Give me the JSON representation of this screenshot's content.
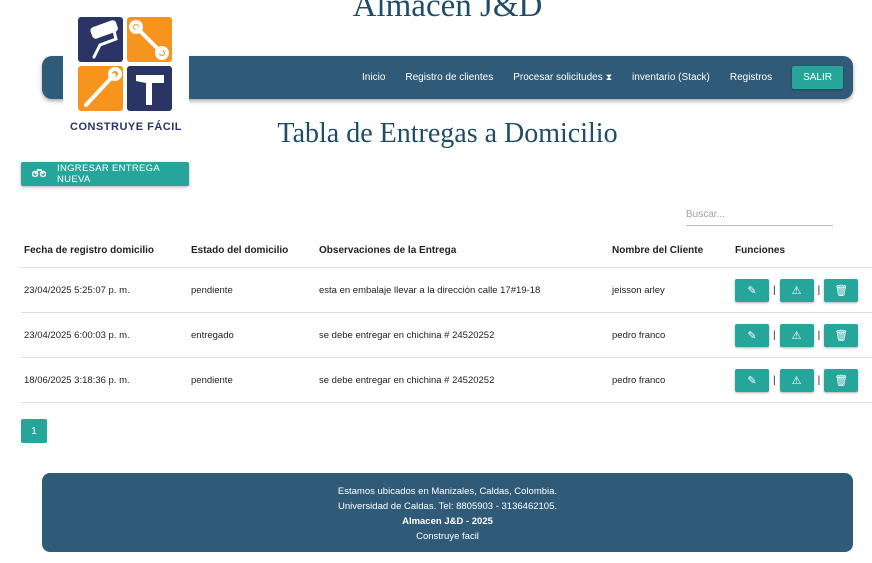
{
  "site_title": "Almacen J&D",
  "logo": {
    "text": "CONSTRUYE FÁCIL",
    "colors": {
      "navy": "#2a3566",
      "orange": "#f7941d"
    }
  },
  "nav": {
    "items": [
      {
        "label": "Inicio"
      },
      {
        "label": "Registro de clientes"
      },
      {
        "label": "Procesar solicitudes",
        "icon": "hourglass-icon"
      },
      {
        "label": "inventario (Stack)"
      },
      {
        "label": "Registros"
      }
    ],
    "logout": "SALIR"
  },
  "page_title": "Tabla de Entregas a Domicilio",
  "new_delivery_button": {
    "label": "INGRESAR ENTREGA NUEVA",
    "icon": "motorcycle-icon"
  },
  "search": {
    "placeholder": "Buscar...",
    "value": ""
  },
  "table": {
    "headers": [
      "Fecha de registro domicilio",
      "Estado del domicilio",
      "Observaciones de la Entrega",
      "Nombre del Cliente",
      "Funciones"
    ],
    "rows": [
      {
        "fecha": "23/04/2025 5:25:07 p. m.",
        "estado": "pendiente",
        "observaciones": "esta en embalaje llevar a la dirección calle 17#19-18",
        "cliente": "jeisson arley"
      },
      {
        "fecha": "23/04/2025 6:00:03 p. m.",
        "estado": "entregado",
        "observaciones": "se debe entregar en chichina # 24520252",
        "cliente": "pedro franco"
      },
      {
        "fecha": "18/06/2025 3:18:36 p. m.",
        "estado": "pendiente",
        "observaciones": "se debe entregar en chichina # 24520252",
        "cliente": "pedro franco"
      }
    ],
    "separator": "|"
  },
  "pagination": {
    "current": "1"
  },
  "footer": {
    "line1": "Estamos ubicados en Manizales, Caldas, Colombia.",
    "line2": "Universidad de Caldas. Tel: 8805903 - 3136462105.",
    "line3": "Almacen J&D - 2025",
    "line4": "Construye facil"
  },
  "colors": {
    "accent": "#26a69a",
    "navbar": "#2f5a78",
    "title": "#1f4c66"
  }
}
